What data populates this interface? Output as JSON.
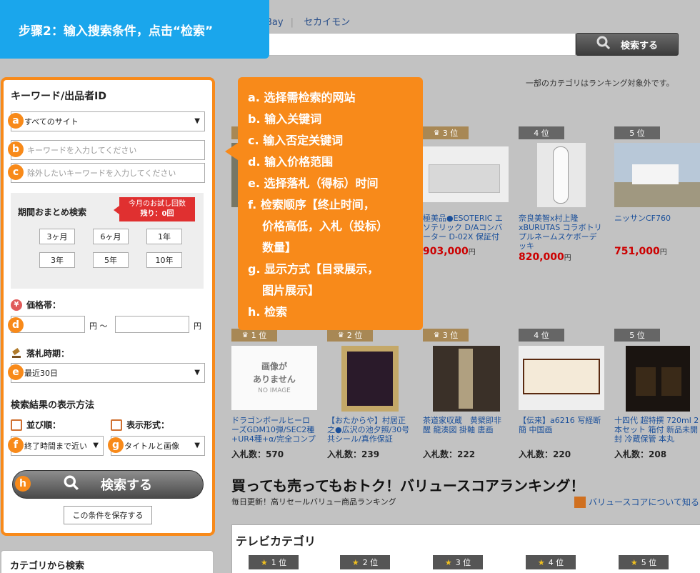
{
  "banner": {
    "text": "步骤2：输入搜索条件，点击“检索”"
  },
  "top_nav": {
    "items": [
      "Bay",
      "セカイモン"
    ]
  },
  "top_search": {
    "button_label": "検索する"
  },
  "left_panel": {
    "title": "キーワード/出品者ID",
    "site_select": "すべてのサイト",
    "keyword_placeholder": "キーワードを入力してください",
    "exclude_placeholder": "除外したいキーワードを入力してください",
    "period": {
      "title": "期間おまとめ検索",
      "trial_line1": "今月のお試し回数",
      "trial_line2": "残り：0回",
      "buttons": [
        "3ヶ月",
        "6ヶ月",
        "1年",
        "3年",
        "5年",
        "10年"
      ]
    },
    "price_label": "価格帯：",
    "price_unit": "円",
    "price_sep": "〜",
    "end_label": "落札時期：",
    "end_select": "最近30日",
    "display_heading": "検索結果の表示方法",
    "sort_label": "並び順：",
    "sort_select": "終了時間まで近い",
    "view_label": "表示形式：",
    "view_select": "タイトルと画像",
    "search_button": "検索する",
    "save_button": "この条件を保存する",
    "category_search": "カテゴリから検索"
  },
  "badges": [
    "a",
    "b",
    "c",
    "d",
    "e",
    "f",
    "g",
    "h"
  ],
  "annotation": {
    "lines": [
      "a. 选择需检索的网站",
      "b. 输入关键词",
      "c. 输入否定关键词",
      "d. 输入价格范围",
      "e. 选择落札（得标）时间",
      "f. 检索顺序【终止时间，",
      "价格高低，入札（投标）",
      "数量】",
      "g. 显示方式【目录展示，",
      "图片展示】",
      "h. 检索"
    ]
  },
  "right": {
    "note": "一部のカテゴリはランキング対象外です。",
    "row1": [
      {
        "rank": "3 位",
        "title": "極美品●ESOTERIC エソテリック D/Aコンバーター D-02X 保証付",
        "price": "903,000",
        "unit": "円"
      },
      {
        "rank": "4 位",
        "title": "奈良美智x村上隆 xBURUTAS コラボトリプルネームスケボーデッキ",
        "price": "820,000",
        "unit": "円"
      },
      {
        "rank": "5 位",
        "title": "ニッサンCF760",
        "price": "751,000",
        "unit": "円"
      }
    ],
    "row2": [
      {
        "rank": "1 位",
        "title": "ドラゴンボールヒーローズGDM10弾/SEC2種+UR4種+α/完全コンプ",
        "bid": "570",
        "noimage1": "画像が",
        "noimage2": "ありません",
        "noimage3": "NO IMAGE"
      },
      {
        "rank": "2 位",
        "title": "【おたからや】村居正之●広沢の池夕照/30号共シール/真作保証",
        "bid": "239"
      },
      {
        "rank": "3 位",
        "title": "茶道家収蔵　黄檗即非 醒 龍湊図 掛軸 唐画",
        "bid": "222"
      },
      {
        "rank": "4 位",
        "title": "【伝来】a6216 写経断簡 中国画",
        "bid": "220"
      },
      {
        "rank": "5 位",
        "title": "十四代 超特撰 720ml 2本セット 箱付 新品未開封 冷蔵保管 本丸",
        "bid": "208"
      }
    ],
    "bid_label": "入札数：",
    "section_title": "買っても売ってもおトク！バリュースコアランキング！",
    "section_sub": "毎日更新！高リセールバリュー商品ランキング",
    "section_link": "バリュースコアについて知る",
    "tv_title": "テレビカテゴリ",
    "tv_ranks": [
      "1 位",
      "2 位",
      "3 位",
      "4 位",
      "5 位"
    ]
  }
}
